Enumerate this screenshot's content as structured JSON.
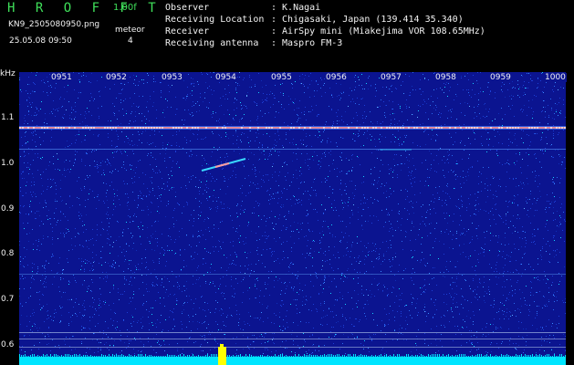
{
  "header": {
    "app_logo": "H R O F F T",
    "version": "1.00f",
    "filename": "KN9_2505080950.png",
    "mode": "meteor",
    "count": "4",
    "datetime": "25.05.08 09:50",
    "info": [
      {
        "key": "Observer",
        "value": ": K.Nagai"
      },
      {
        "key": "Receiving Location",
        "value": ": Chigasaki, Japan (139.414 35.340)"
      },
      {
        "key": "Receiver",
        "value": ": AirSpy mini (Miakejima VOR 108.65MHz)"
      },
      {
        "key": "Receiving antenna",
        "value": ": Maspro FM-3"
      }
    ]
  },
  "axes": {
    "y_unit": "kHz",
    "y_ticks": [
      "1.1",
      "1.0",
      "0.9",
      "0.8",
      "0.7",
      "0.6"
    ],
    "x_ticks": [
      "0951",
      "0952",
      "0953",
      "0954",
      "0955",
      "0956",
      "0957",
      "0958",
      "0959",
      "1000"
    ]
  },
  "colors": {
    "background": "#0b1490",
    "carrier": "#ff9090",
    "level_bar": "#00e5ff",
    "peak": "#ffff00",
    "logo": "#3fe05a"
  }
}
